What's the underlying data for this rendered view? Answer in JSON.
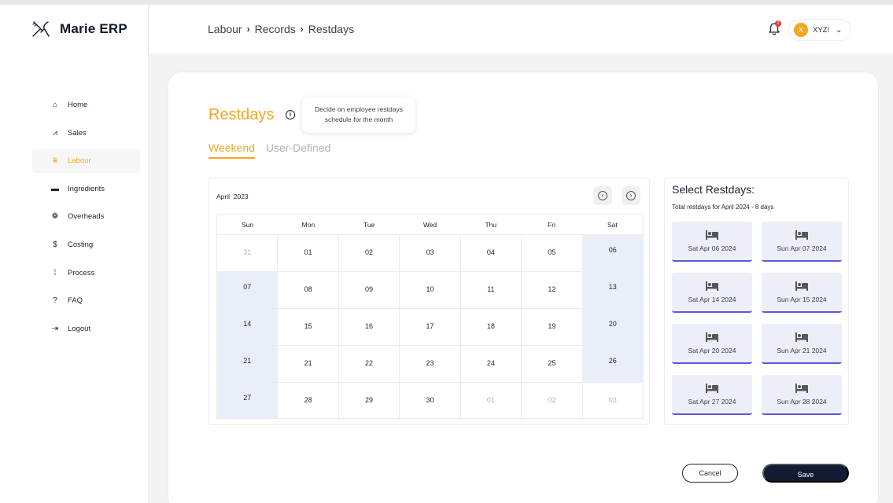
{
  "app": {
    "name": "Marie ERP",
    "logo_icon": "utensils-icon"
  },
  "sidebar": {
    "items": [
      {
        "label": "Home",
        "icon": "home-icon",
        "glyph": "⌂",
        "active": false
      },
      {
        "label": "Sales",
        "icon": "sales-chart-icon",
        "glyph": "⩘",
        "active": false
      },
      {
        "label": "Labour",
        "icon": "labour-icon",
        "glyph": "⩸",
        "active": true
      },
      {
        "label": "Ingredients",
        "icon": "ingredients-icon",
        "glyph": "▬",
        "active": false
      },
      {
        "label": "Overheads",
        "icon": "overheads-icon",
        "glyph": "❁",
        "active": false
      },
      {
        "label": "Costing",
        "icon": "dollar-icon",
        "glyph": "$",
        "active": false
      },
      {
        "label": "Process",
        "icon": "process-icon",
        "glyph": "⁞",
        "active": false
      },
      {
        "label": "FAQ",
        "icon": "question-icon",
        "glyph": "?",
        "active": false
      },
      {
        "label": "Logout",
        "icon": "logout-icon",
        "glyph": "⇥",
        "active": false
      }
    ]
  },
  "header": {
    "breadcrumb": [
      "Labour",
      "Records",
      "Restdays"
    ],
    "breadcrumb_sep": "›",
    "notification_count": "2",
    "user": {
      "initial": "X",
      "name": "XYZ!"
    }
  },
  "page": {
    "title": "Restdays",
    "tooltip": "Decide on employee restdays schedule for the month",
    "tabs": [
      {
        "label": "Weekend",
        "active": true
      },
      {
        "label": "User-Defined",
        "active": false
      }
    ]
  },
  "calendar": {
    "month": "April",
    "year": "2023",
    "weekdays": [
      "Sun",
      "Mon",
      "Tue",
      "Wed",
      "Thu",
      "Fri",
      "Sat"
    ],
    "weeks": [
      [
        "31",
        "01",
        "02",
        "03",
        "04",
        "05",
        "06"
      ],
      [
        "07",
        "08",
        "09",
        "10",
        "11",
        "12",
        "13"
      ],
      [
        "14",
        "15",
        "16",
        "17",
        "18",
        "19",
        "20"
      ],
      [
        "21",
        "21",
        "22",
        "23",
        "24",
        "25",
        "26"
      ],
      [
        "27",
        "28",
        "29",
        "30",
        "01",
        "02",
        "03"
      ]
    ],
    "muted_cells": [
      [
        0,
        0
      ],
      [
        4,
        4
      ],
      [
        4,
        5
      ],
      [
        4,
        6
      ]
    ],
    "weekend_highlight_color": "#e9eef9"
  },
  "restdays": {
    "title": "Select Restdays:",
    "subtitle": "Total restdays for April 2024 - 8 days",
    "items": [
      "Sat Apr 06 2024",
      "Sun Apr 07 2024",
      "Sat Apr 14 2024",
      "Sun Apr 15 2024",
      "Sat Apr 20 2024",
      "Sun Apr 21 2024",
      "Sat Apr 27 2024",
      "Sun Apr 28 2024"
    ],
    "item_icon": "bed-icon"
  },
  "actions": {
    "cancel_label": "Cancel",
    "save_label": "Save"
  },
  "colors": {
    "accent": "#f5a623",
    "primary": "#111c33",
    "card_underline": "#5b5bd6",
    "notification": "#e53935"
  }
}
